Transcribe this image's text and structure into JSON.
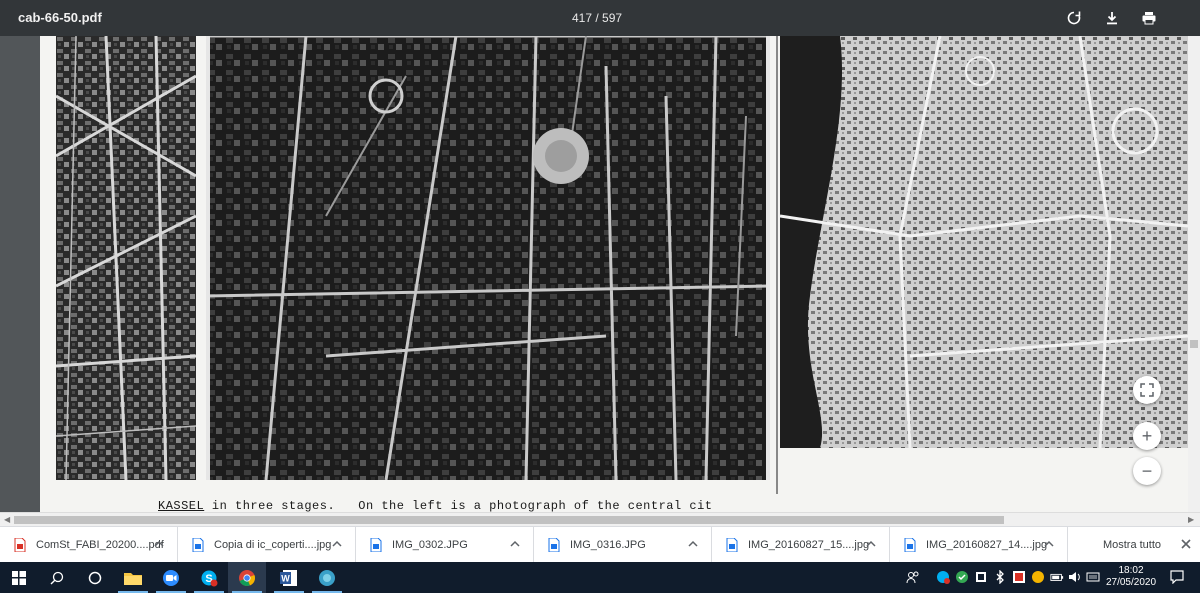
{
  "toolbar": {
    "document_title": "cab-66-50.pdf",
    "page_indicator": "417 / 597",
    "rotate_icon": "rotate-icon",
    "download_icon": "download-icon",
    "print_icon": "print-icon"
  },
  "page": {
    "caption_title": "KASSEL",
    "caption_rest": " in three stages.   On the left is a photograph of the central cit"
  },
  "viewer_controls": {
    "fit_icon": "fit-to-page-icon",
    "zoom_in_label": "+",
    "zoom_out_label": "−"
  },
  "downloads": {
    "items": [
      {
        "name": "ComSt_FABI_20200....pdf",
        "type": "pdf"
      },
      {
        "name": "Copia di ic_coperti....jpg",
        "type": "jpg"
      },
      {
        "name": "IMG_0302.JPG",
        "type": "jpg"
      },
      {
        "name": "IMG_0316.JPG",
        "type": "jpg"
      },
      {
        "name": "IMG_20160827_15....jpg",
        "type": "jpg"
      },
      {
        "name": "IMG_20160827_14....jpg",
        "type": "jpg"
      }
    ],
    "show_all_label": "Mostra tutto"
  },
  "taskbar": {
    "time": "18:02",
    "date": "27/05/2020",
    "apps": [
      "start-icon",
      "search-icon",
      "cortana-icon",
      "file-explorer-icon",
      "zoom-icon",
      "skype-icon",
      "chrome-icon",
      "word-icon",
      "edge-icon"
    ]
  },
  "colors": {
    "toolbar_bg": "#323639",
    "viewer_bg": "#525659",
    "taskbar_bg": "#101c2c",
    "pdf_icon_red": "#d93025",
    "image_icon_blue": "#1a73e8"
  }
}
